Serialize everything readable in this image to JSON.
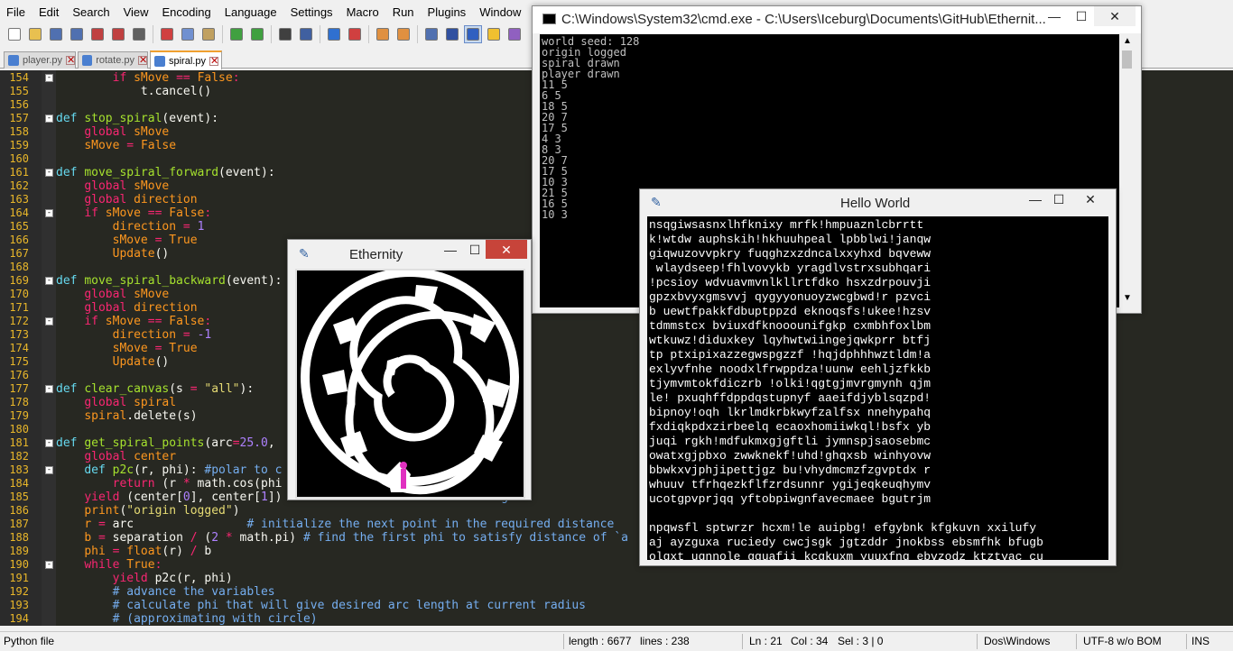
{
  "menu": [
    "File",
    "Edit",
    "Search",
    "View",
    "Encoding",
    "Language",
    "Settings",
    "Macro",
    "Run",
    "Plugins",
    "Window",
    "?"
  ],
  "tabs": [
    {
      "label": "player.py",
      "active": false
    },
    {
      "label": "rotate.py",
      "active": false
    },
    {
      "label": "spiral.py",
      "active": true
    }
  ],
  "lines": [
    {
      "n": "154",
      "fold": "-",
      "html": "        <span class='kw'>if</span> <span class='or'>sMove</span> <span class='kw'>==</span> <span class='or'>False</span><span class='kw'>:</span>"
    },
    {
      "n": "155",
      "fold": "",
      "html": "            t.cancel()"
    },
    {
      "n": "156",
      "fold": "",
      "html": ""
    },
    {
      "n": "157",
      "fold": "-",
      "html": "<span class='df'>def</span> <span class='fn'>stop_spiral</span>(event):"
    },
    {
      "n": "158",
      "fold": "",
      "html": "    <span class='kw'>global</span> <span class='or'>sMove</span>"
    },
    {
      "n": "159",
      "fold": "",
      "html": "    <span class='or'>sMove</span> <span class='kw'>=</span> <span class='or'>False</span>"
    },
    {
      "n": "160",
      "fold": "",
      "html": ""
    },
    {
      "n": "161",
      "fold": "-",
      "html": "<span class='df'>def</span> <span class='fn'>move_spiral_forward</span>(event):"
    },
    {
      "n": "162",
      "fold": "",
      "html": "    <span class='kw'>global</span> <span class='or'>sMove</span>"
    },
    {
      "n": "163",
      "fold": "",
      "html": "    <span class='kw'>global</span> <span class='or'>direction</span>"
    },
    {
      "n": "164",
      "fold": "-",
      "html": "    <span class='kw'>if</span> <span class='or'>sMove</span> <span class='kw'>==</span> <span class='or'>False</span><span class='kw'>:</span>"
    },
    {
      "n": "165",
      "fold": "",
      "html": "        <span class='or'>direction</span> <span class='kw'>=</span> <span class='num'>1</span>"
    },
    {
      "n": "166",
      "fold": "",
      "html": "        <span class='or'>sMove</span> <span class='kw'>=</span> <span class='or'>True</span>"
    },
    {
      "n": "167",
      "fold": "",
      "html": "        <span class='or'>Update</span>()"
    },
    {
      "n": "168",
      "fold": "",
      "html": ""
    },
    {
      "n": "169",
      "fold": "-",
      "html": "<span class='df'>def</span> <span class='fn'>move_spiral_backward</span>(event):"
    },
    {
      "n": "170",
      "fold": "",
      "html": "    <span class='kw'>global</span> <span class='or'>sMove</span>"
    },
    {
      "n": "171",
      "fold": "",
      "html": "    <span class='kw'>global</span> <span class='or'>direction</span>"
    },
    {
      "n": "172",
      "fold": "-",
      "html": "    <span class='kw'>if</span> <span class='or'>sMove</span> <span class='kw'>==</span> <span class='or'>False</span><span class='kw'>:</span>"
    },
    {
      "n": "173",
      "fold": "",
      "html": "        <span class='or'>direction</span> <span class='kw'>=</span> <span class='num'>-1</span>"
    },
    {
      "n": "174",
      "fold": "",
      "html": "        <span class='or'>sMove</span> <span class='kw'>=</span> <span class='or'>True</span>"
    },
    {
      "n": "175",
      "fold": "",
      "html": "        <span class='or'>Update</span>()"
    },
    {
      "n": "176",
      "fold": "",
      "html": ""
    },
    {
      "n": "177",
      "fold": "-",
      "html": "<span class='df'>def</span> <span class='fn'>clear_canvas</span>(s <span class='kw'>=</span> <span class='str'>\"all\"</span>):"
    },
    {
      "n": "178",
      "fold": "",
      "html": "    <span class='kw'>global</span> <span class='or'>spiral</span>"
    },
    {
      "n": "179",
      "fold": "",
      "html": "    <span class='or'>spiral</span>.delete(s)"
    },
    {
      "n": "180",
      "fold": "",
      "html": ""
    },
    {
      "n": "181",
      "fold": "-",
      "html": "<span class='df'>def</span> <span class='fn'>get_spiral_points</span>(arc<span class='kw'>=</span><span class='num'>25.0</span>,"
    },
    {
      "n": "182",
      "fold": "",
      "html": "    <span class='kw'>global</span> <span class='or'>center</span>"
    },
    {
      "n": "183",
      "fold": "-",
      "html": "    <span class='df'>def</span> <span class='fn'>p2c</span>(r, phi): <span class='cm'>#polar to c</span>"
    },
    {
      "n": "184",
      "fold": "",
      "html": "        <span class='kw'>return</span> (r <span class='kw'>*</span> math.cos(phi"
    },
    {
      "n": "185",
      "fold": "",
      "html": "    <span class='kw'>yield</span> (center[<span class='num'>0</span>], center[<span class='num'>1</span>])                            <span class='cm'>origin</span>"
    },
    {
      "n": "186",
      "fold": "",
      "html": "    <span class='or'>print</span>(<span class='str'>\"origin logged\"</span>)"
    },
    {
      "n": "187",
      "fold": "",
      "html": "    <span class='or'>r</span> <span class='kw'>=</span> arc                <span class='cm'># initialize the next point in the required distance</span>"
    },
    {
      "n": "188",
      "fold": "",
      "html": "    <span class='or'>b</span> <span class='kw'>=</span> separation <span class='kw'>/</span> (<span class='num'>2</span> <span class='kw'>*</span> math.pi) <span class='cm'># find the first phi to satisfy distance of `a</span>"
    },
    {
      "n": "189",
      "fold": "",
      "html": "    <span class='or'>phi</span> <span class='kw'>=</span> <span class='or'>float</span>(r) <span class='kw'>/</span> b"
    },
    {
      "n": "190",
      "fold": "-",
      "html": "    <span class='kw'>while</span> <span class='or'>True</span><span class='kw'>:</span>"
    },
    {
      "n": "191",
      "fold": "",
      "html": "        <span class='kw'>yield</span> p2c(r, phi)"
    },
    {
      "n": "192",
      "fold": "",
      "html": "        <span class='cm'># advance the variables</span>"
    },
    {
      "n": "193",
      "fold": "",
      "html": "        <span class='cm'># calculate phi that will give desired arc length at current radius</span>"
    },
    {
      "n": "194",
      "fold": "",
      "html": "        <span class='cm'># (approximating with circle)</span>"
    }
  ],
  "status": {
    "lang": "Python file",
    "length": "length : 6677",
    "lines": "lines : 238",
    "ln": "Ln : 21",
    "col": "Col : 34",
    "sel": "Sel : 3 | 0",
    "eol": "Dos\\Windows",
    "enc": "UTF-8 w/o BOM",
    "ins": "INS"
  },
  "cmd": {
    "title": "C:\\Windows\\System32\\cmd.exe - C:\\Users\\Iceburg\\Documents\\GitHub\\Ethernit...",
    "lines": [
      "world seed: 128",
      "origin logged",
      "spiral drawn",
      "player drawn",
      "11 5",
      "6 5",
      "18 5",
      "20 7",
      "17 5",
      "4 3",
      "8 3",
      "20 7",
      "17 5",
      "10 3",
      "21 5",
      "16 5",
      "10 3"
    ]
  },
  "hello": {
    "title": "Hello World",
    "lines": [
      "nsqgiwsasnxlhfknixy mrfk!hmpuaznlcbrrtt",
      "k!wtdw auphskih!hkhuuhpeal lpbblwi!janqw",
      "giqwuzovvpkry fuqghzxzdncalxxyhxd bqveww",
      " wlaydseep!fhlvovykb yragdlvstrxsubhqari",
      "!pcsioy wdvuavmvnlkllrtfdko hsxzdrpouvji",
      "gpzxbvyxgmsvvj qygyyonuoyzwcgbwd!r pzvci",
      "b uewtfpakkfdbuptppzd eknoqsfs!ukee!hzsv",
      "tdmmstcx bviuxdfknooounifgkp cxmbhfoxlbm",
      "wtkuwz!diduxkey lqyhwtwiingejqwkprr btfj",
      "tp ptxipixazzegwspgzzf !hqjdphhhwztldm!a",
      "exlyvfnhe noodxlfrwppdza!uunw eehljzfkkb",
      "tjymvmtokfdiczrb !olki!qgtgjmvrgmynh qjm",
      "le! pxuqhffdppdqstupnyf aaeifdjyblsqzpd!",
      "bipnoy!oqh lkrlmdkrbkwyfzalfsx nnehypahq",
      "fxdiqkpdxzirbeelq ecaoxhomiiwkql!bsfx yb",
      "juqi rgkh!mdfukmxgjgftli jymnspjsaosebmc",
      "owatxgjpbxo zwwknekf!uhd!ghqxsb winhyovw",
      "bbwkxvjphjipettjgz bu!vhydmcmzfzgvptdx r",
      "whuuv tfrhqezkflfzrdsunnr ygijeqkeuqhymv",
      "ucotgpvprjqq yftobpiwgnfavecmaee bgutrjm",
      "",
      "npqwsfl sptwrzr hcxm!le auipbg! efgybnk kfgkuvn xxilufy",
      "aj ayzguxa ruciedy cwcjsgk jgtzddr jnokbss ebsmfhk bfugb",
      "olqxt uqnnole gguafii kcgkuxm yuuxfnq ebvzodz ktztvac cu"
    ]
  },
  "ethernity": {
    "title": "Ethernity"
  },
  "controls": {
    "min": "—",
    "max": "☐",
    "close": "✕"
  }
}
